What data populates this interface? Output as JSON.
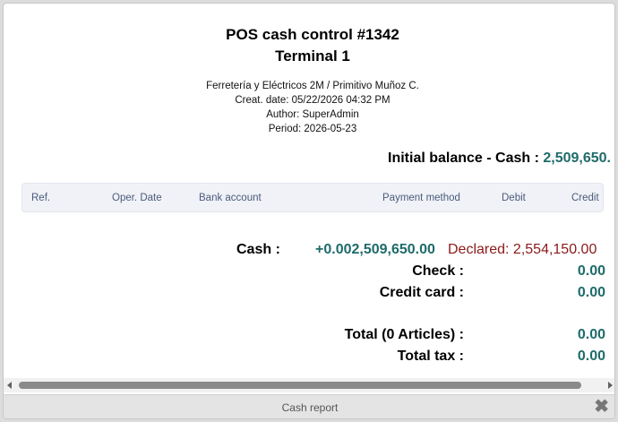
{
  "report": {
    "title": "POS cash control #1342",
    "terminal": "Terminal 1",
    "company": "Ferretería y Eléctricos 2M / Primitivo Muñoz C.",
    "creation_date": "Creat. date: 05/22/2026 04:32 PM",
    "author": "Author: SuperAdmin",
    "period": "Period: 2026-05-23"
  },
  "initial_balance": {
    "label": "Initial balance - Cash : ",
    "value": "2,509,650."
  },
  "table": {
    "columns": [
      "Ref.",
      "Oper. Date",
      "Bank account",
      "Payment method",
      "Debit",
      "Credit"
    ]
  },
  "summary": {
    "cash_label": "Cash :",
    "cash_amount": "+0.002,509,650.00",
    "cash_declared": "Declared: 2,554,150.00",
    "check_label": "Check :",
    "check_value": "0.00",
    "credit_card_label": "Credit card :",
    "credit_card_value": "0.00",
    "total_label": "Total (0 Articles) :",
    "total_value": "0.00",
    "tax_label": "Total tax :",
    "tax_value": "0.00"
  },
  "footer": {
    "title": "Cash report",
    "close_icon": "close-icon"
  },
  "colors": {
    "amount": "#1f6b6b",
    "declared": "#8b1a1a",
    "header_bg": "#f0f2f7",
    "header_text": "#4b5b7a"
  }
}
